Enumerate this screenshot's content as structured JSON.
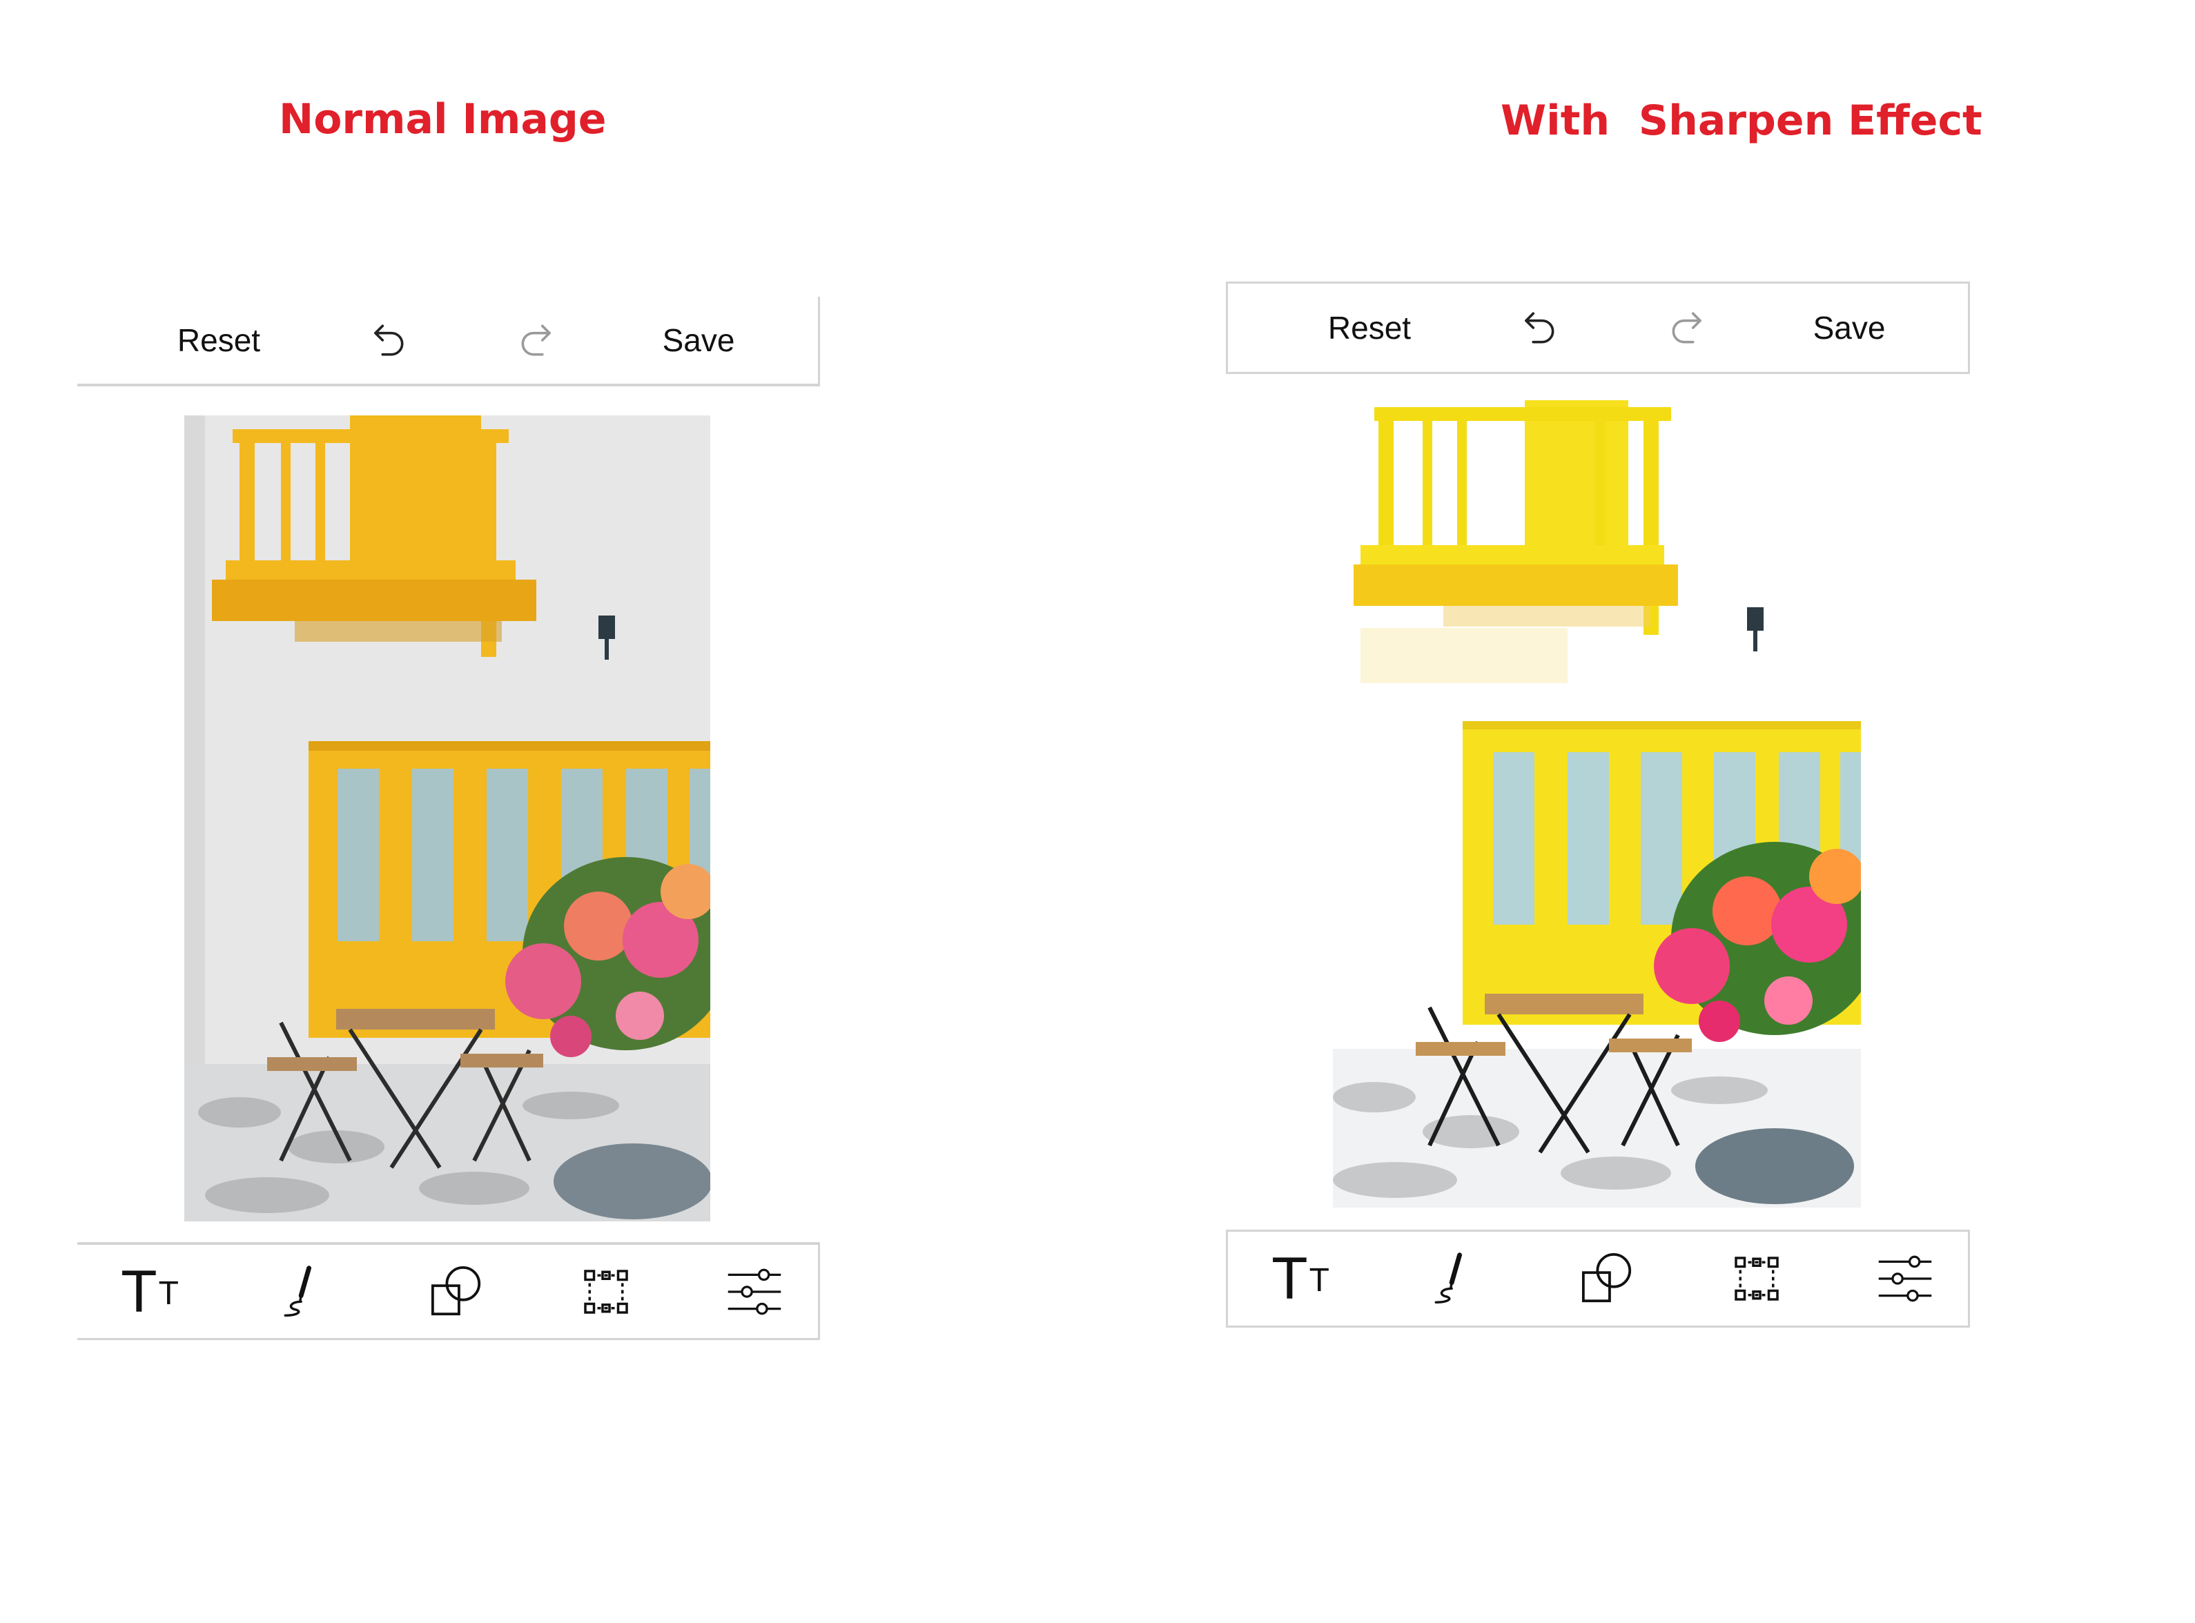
{
  "captions": {
    "left": "Normal Image",
    "right": "With  Sharpen Effect"
  },
  "panels": [
    {
      "id": "normal",
      "top_toolbar": {
        "reset_label": "Reset",
        "save_label": "Save",
        "undo_icon": "undo-icon",
        "redo_icon": "redo-icon"
      },
      "bottom_toolbar": [
        "text-tool-icon",
        "freehand-draw-icon",
        "shapes-icon",
        "crop-icon",
        "adjust-filters-icon"
      ],
      "text_tool_glyph": {
        "big": "T",
        "small": "T"
      }
    },
    {
      "id": "sharpen",
      "top_toolbar": {
        "reset_label": "Reset",
        "save_label": "Save",
        "undo_icon": "undo-icon",
        "redo_icon": "redo-icon"
      },
      "bottom_toolbar": [
        "text-tool-icon",
        "freehand-draw-icon",
        "shapes-icon",
        "crop-icon",
        "adjust-filters-icon"
      ],
      "text_tool_glyph": {
        "big": "T",
        "small": "T"
      }
    }
  ],
  "colors": {
    "caption": "#e0202a",
    "yellow_normal": "#f2b81e",
    "yellow_sharpen": "#f7e11e",
    "wall_normal": "#e9e9ea",
    "wall_sharpen": "#ffffff",
    "toolbar_border": "#d4d4d4"
  }
}
